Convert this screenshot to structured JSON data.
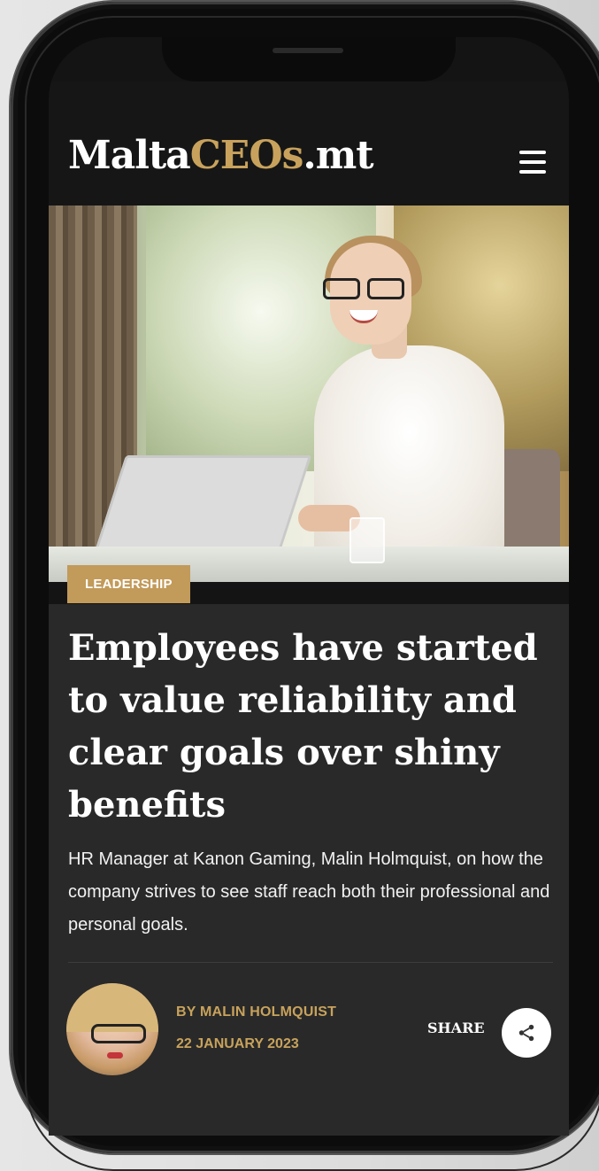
{
  "header": {
    "logo_part1": "Malta",
    "logo_part2": "CEOs",
    "logo_part3": ".mt",
    "menu_icon": "hamburger-menu-icon"
  },
  "colors": {
    "accent": "#c8a25c",
    "badge_bg": "#c29a59",
    "article_bg": "#292929",
    "header_bg": "#161616"
  },
  "article": {
    "category": "LEADERSHIP",
    "headline": "Employees have started to value reliability and clear goals over shiny benefits",
    "summary": "HR Manager at Kanon Gaming, Malin Holmquist, on how the company strives to see staff reach both their professional and personal goals.",
    "author": "BY MALIN HOLMQUIST",
    "date": "22 JANUARY 2023",
    "share_label": "SHARE",
    "share_icon": "share-icon"
  }
}
